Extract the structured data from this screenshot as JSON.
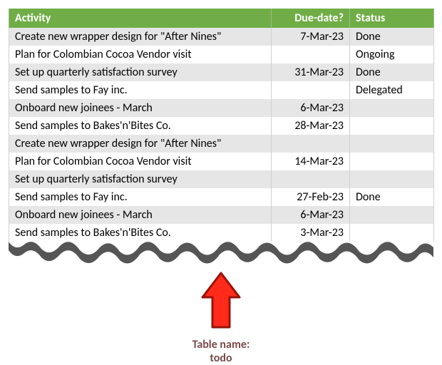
{
  "columns": {
    "activity": "Activity",
    "due": "Due-date?",
    "status": "Status"
  },
  "rows": [
    {
      "activity": "Create new wrapper design for \"After Nines\"",
      "due": "7-Mar-23",
      "status": "Done"
    },
    {
      "activity": "Plan for Colombian Cocoa Vendor visit",
      "due": "",
      "status": "Ongoing"
    },
    {
      "activity": "Set up quarterly satisfaction survey",
      "due": "31-Mar-23",
      "status": "Done"
    },
    {
      "activity": "Send samples to Fay inc.",
      "due": "",
      "status": "Delegated"
    },
    {
      "activity": "Onboard new joinees - March",
      "due": "6-Mar-23",
      "status": ""
    },
    {
      "activity": "Send samples to Bakes'n'Bites Co.",
      "due": "28-Mar-23",
      "status": ""
    },
    {
      "activity": "Create new wrapper design for \"After Nines\"",
      "due": "",
      "status": ""
    },
    {
      "activity": "Plan for Colombian Cocoa Vendor visit",
      "due": "14-Mar-23",
      "status": ""
    },
    {
      "activity": "Set up quarterly satisfaction survey",
      "due": "",
      "status": ""
    },
    {
      "activity": "Send samples to Fay inc.",
      "due": "27-Feb-23",
      "status": "Done"
    },
    {
      "activity": "Onboard new joinees - March",
      "due": "6-Mar-23",
      "status": ""
    },
    {
      "activity": "Send samples to Bakes'n'Bites Co.",
      "due": "3-Mar-23",
      "status": ""
    }
  ],
  "caption": {
    "line1": "Table name:",
    "line2": "todo"
  }
}
